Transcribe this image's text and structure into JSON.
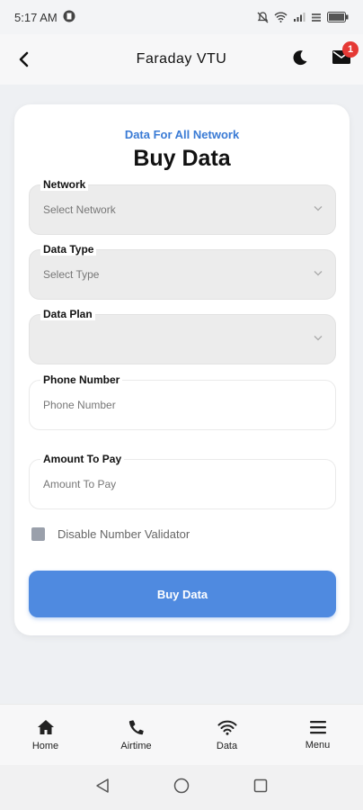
{
  "status_bar": {
    "time": "5:17 AM"
  },
  "app_bar": {
    "title": "Faraday VTU",
    "mail_badge": "1"
  },
  "form": {
    "subtitle": "Data For All Network",
    "title": "Buy Data",
    "network": {
      "label": "Network",
      "placeholder": "Select Network"
    },
    "data_type": {
      "label": "Data Type",
      "placeholder": "Select Type"
    },
    "data_plan": {
      "label": "Data Plan",
      "placeholder": ""
    },
    "phone": {
      "label": "Phone Number",
      "placeholder": "Phone Number"
    },
    "amount": {
      "label": "Amount To Pay",
      "placeholder": "Amount To Pay"
    },
    "validator_label": "Disable Number Validator",
    "submit_label": "Buy Data"
  },
  "bottom_nav": [
    {
      "label": "Home",
      "icon": "home-icon"
    },
    {
      "label": "Airtime",
      "icon": "phone-icon"
    },
    {
      "label": "Data",
      "icon": "wifi-icon"
    },
    {
      "label": "Menu",
      "icon": "menu-icon"
    }
  ],
  "colors": {
    "accent": "#4f8ae0",
    "subtitle": "#3a7bd5",
    "badge": "#e53935"
  }
}
